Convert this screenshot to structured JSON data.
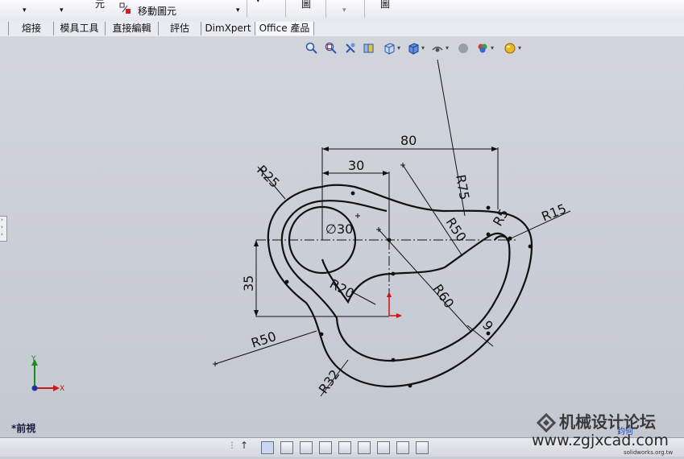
{
  "toolbar": {
    "yuan_label": "元",
    "move_entity_label": "移動圖元",
    "tu1": "圖",
    "tu2": "圖"
  },
  "tabs": [
    {
      "label": "熔接"
    },
    {
      "label": "模具工具"
    },
    {
      "label": "直接編輯"
    },
    {
      "label": "評估"
    },
    {
      "label": "DimXpert"
    },
    {
      "label": "Office 產品"
    }
  ],
  "headsup_icons": [
    "zoom-to-fit-icon",
    "zoom-area-icon",
    "previous-view-icon",
    "section-view-icon",
    "view-orientation-icon",
    "display-style-icon",
    "hide-show-icon",
    "edit-appearance-icon",
    "apply-scene-icon",
    "view-settings-icon"
  ],
  "view": {
    "name": "*前視",
    "triad": {
      "y": "Y",
      "x": "X"
    }
  },
  "dimensions": {
    "d80": "80",
    "d30": "30",
    "d35": "35",
    "dia30": "∅30",
    "r25": "R25",
    "r75": "R75",
    "r50a": "R50",
    "r5": "R5",
    "r15": "R15",
    "r20": "R20",
    "r60": "R60",
    "r50b": "R50",
    "r32": "R32",
    "d9": "9"
  },
  "watermark": {
    "title": "机械设计论坛",
    "url": "www.zgjxcad.com",
    "sub": "solidworks.org.tw",
    "badge": "鈞何"
  },
  "colors": {
    "background": "#c8ccd6",
    "sketch": "#111111",
    "origin_arrow": "#d01010",
    "triad_y": "#1a8a1a",
    "triad_x": "#cc1a1a"
  }
}
